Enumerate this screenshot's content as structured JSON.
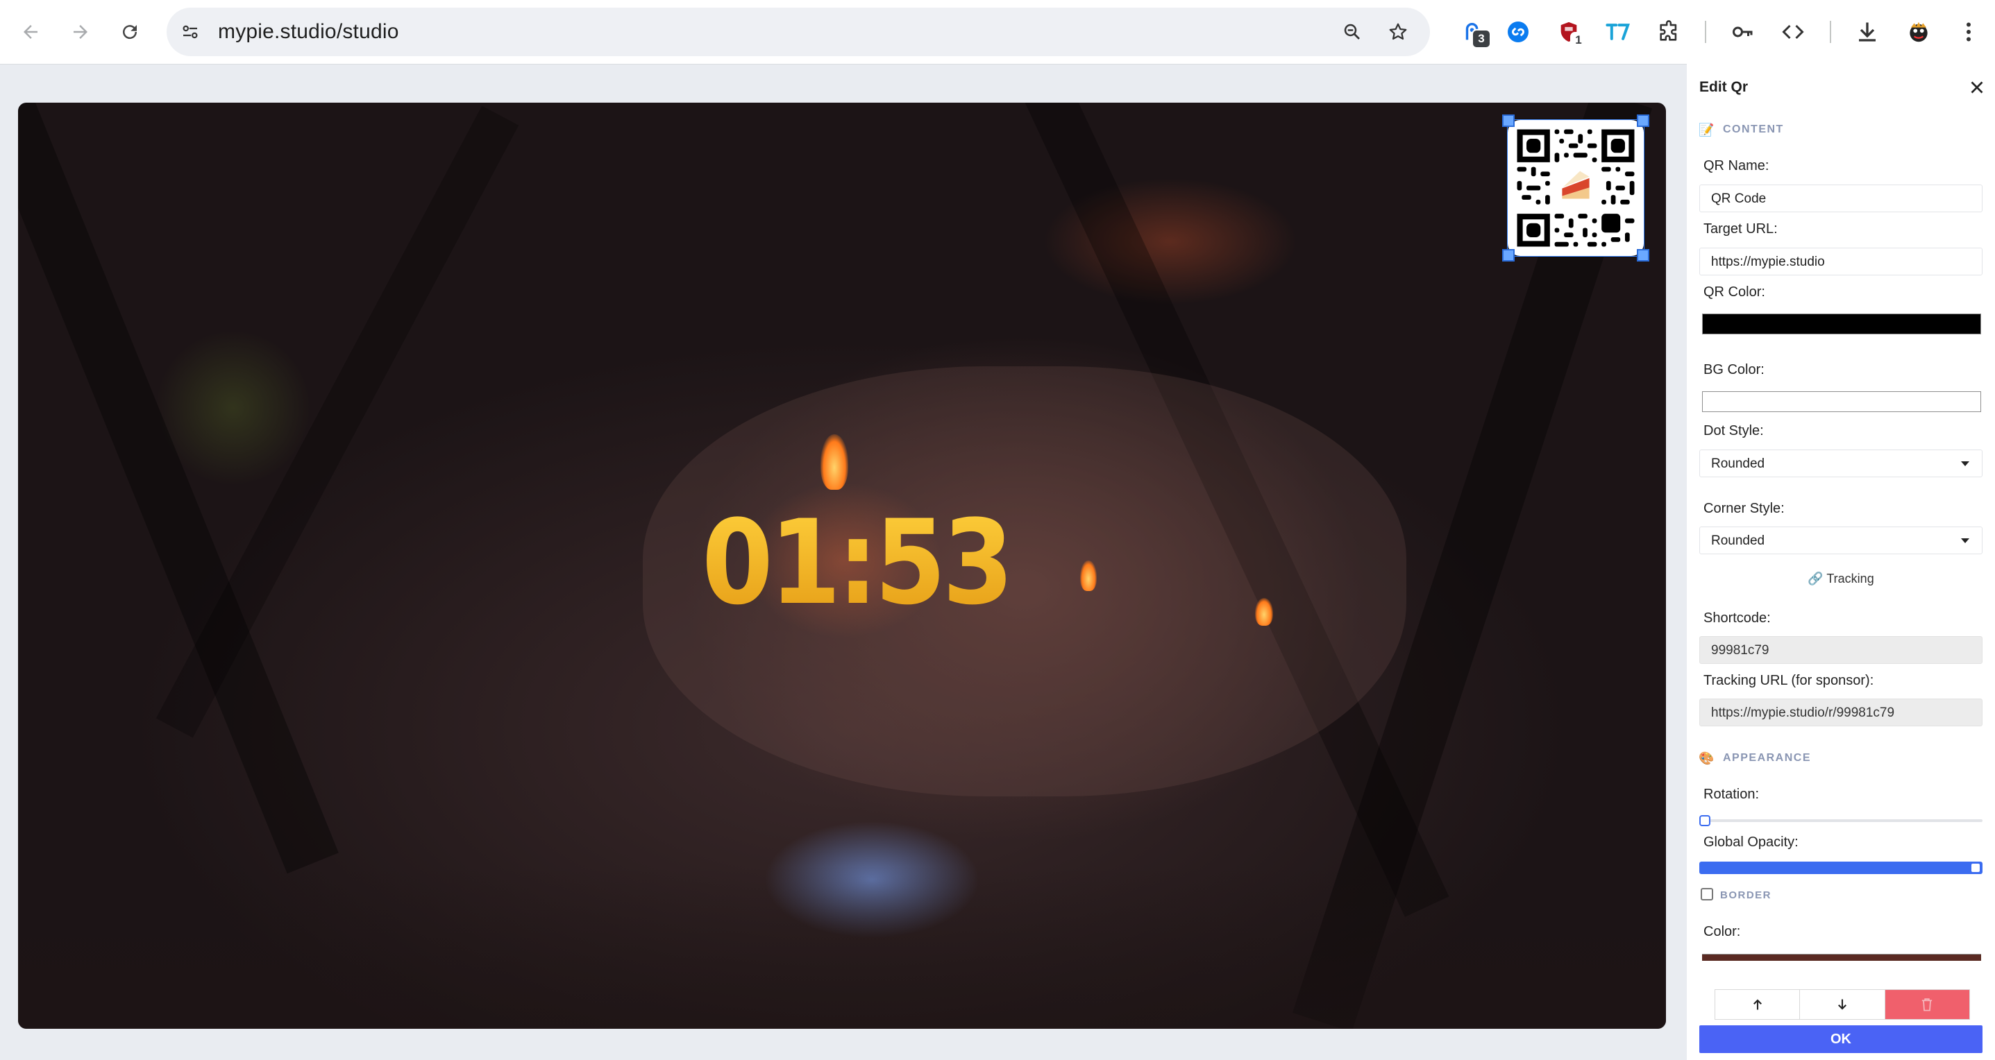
{
  "browser": {
    "url": "mypie.studio/studio",
    "extensions": [
      {
        "name": "extension-ai",
        "badge": "3"
      },
      {
        "name": "extension-shazam",
        "badge": ""
      },
      {
        "name": "extension-shield",
        "badge": "1"
      },
      {
        "name": "extension-translate",
        "badge": ""
      }
    ]
  },
  "stage": {
    "timer": "01:53"
  },
  "panel": {
    "title": "Edit Qr",
    "content_section": "CONTENT",
    "qr_name_label": "QR Name:",
    "qr_name_value": "QR Code",
    "target_url_label": "Target URL:",
    "target_url_value": "https://mypie.studio",
    "qr_color_label": "QR Color:",
    "qr_color": "#000000",
    "bg_color_label": "BG Color:",
    "bg_color": "#ffffff",
    "dot_style_label": "Dot Style:",
    "dot_style_value": "Rounded",
    "corner_style_label": "Corner Style:",
    "corner_style_value": "Rounded",
    "tracking_heading": "🔗 Tracking",
    "shortcode_label": "Shortcode:",
    "shortcode_value": "99981c79",
    "tracking_url_label": "Tracking URL (for sponsor):",
    "tracking_url_value": "https://mypie.studio/r/99981c79",
    "appearance_section": "APPEARANCE",
    "rotation_label": "Rotation:",
    "rotation_value": 0,
    "opacity_label": "Global Opacity:",
    "opacity_value": 1,
    "border_label": "BORDER",
    "border_checked": false,
    "color_label": "Color:",
    "border_color": "#5a2a22",
    "ok_label": "OK"
  }
}
